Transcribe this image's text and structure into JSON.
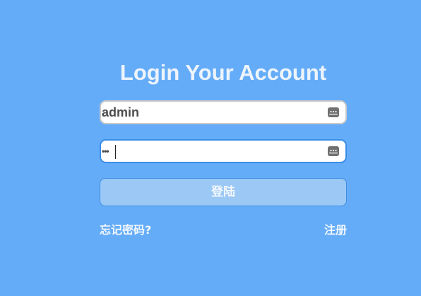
{
  "login_form": {
    "title": "Login Your Account",
    "username": {
      "value": "admin",
      "icon": "password-manager-icon"
    },
    "password": {
      "value": "•••",
      "icon": "password-manager-icon"
    },
    "submit_label": "登陆",
    "forgot_password_label": "忘记密码?",
    "register_label": "注册"
  },
  "colors": {
    "background": "#64acf8",
    "title_text": "#eef4fb",
    "button_fill": "#9cc8f5",
    "button_border": "#3f8fe0",
    "focused_input_border": "#3a8de8",
    "input_border": "#c9c9c9"
  }
}
